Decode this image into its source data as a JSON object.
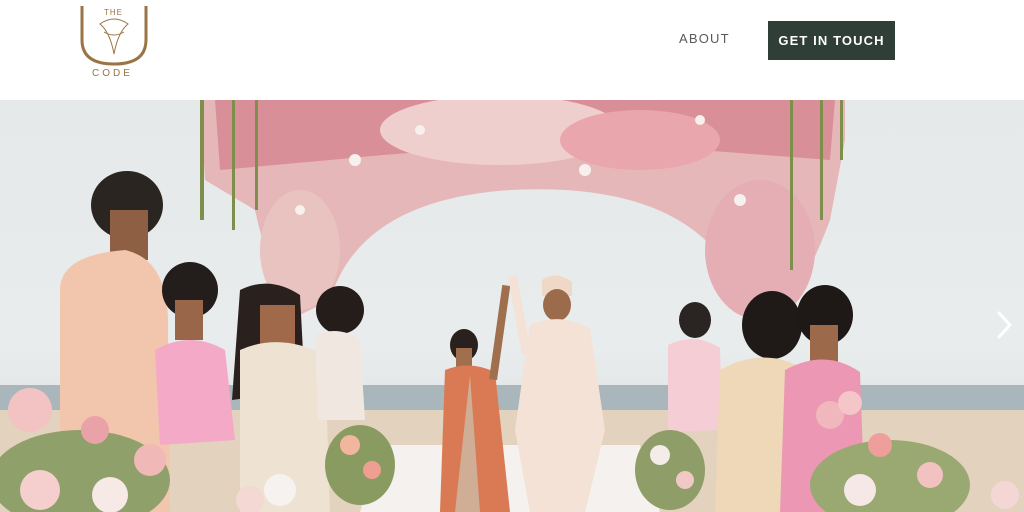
{
  "brand": {
    "logo_top": "THE",
    "logo_bottom": "CODE",
    "logo_color": "#9a7444"
  },
  "nav": {
    "about_label": "ABOUT",
    "cta_label": "GET IN TOUCH",
    "cta_color": "#2f3e37"
  },
  "hero": {
    "next_icon": "chevron-right-icon"
  }
}
